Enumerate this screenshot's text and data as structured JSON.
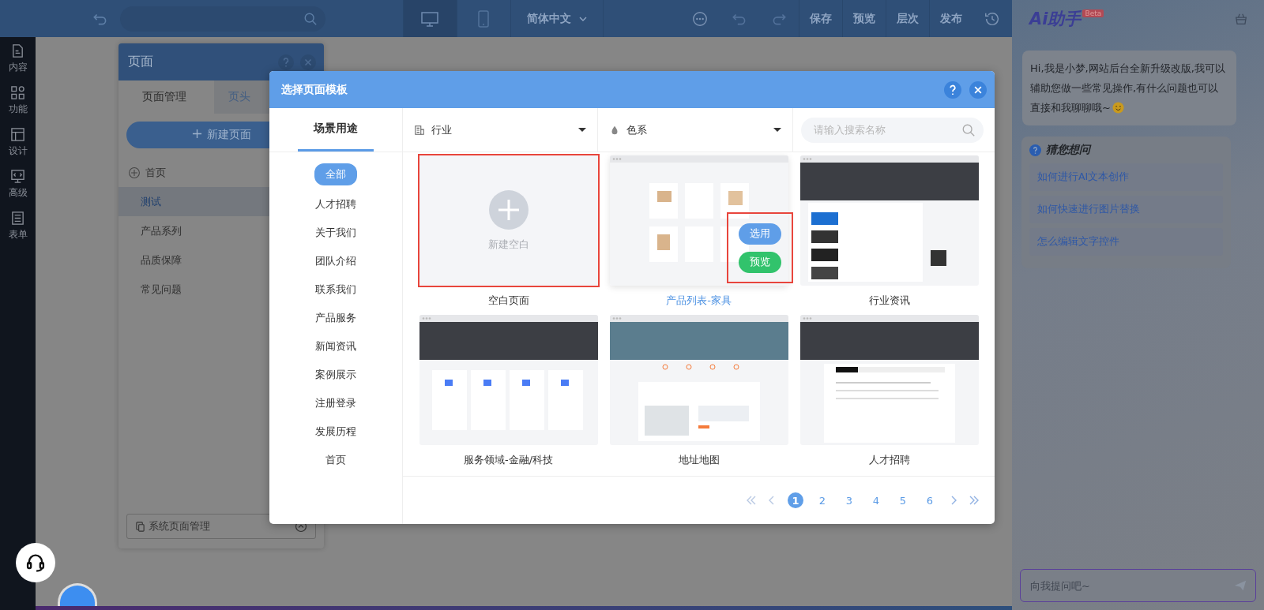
{
  "toolbar": {
    "language": "简体中文",
    "devices": [
      {
        "kind": "desktop",
        "selected": true
      },
      {
        "kind": "mobile",
        "selected": false
      }
    ],
    "actions": [
      "保存",
      "预览",
      "层次",
      "发布"
    ]
  },
  "sidebar": {
    "items": [
      {
        "kind": "doc",
        "label": "内容"
      },
      {
        "kind": "grid",
        "label": "功能"
      },
      {
        "kind": "layout",
        "label": "设计"
      },
      {
        "kind": "code",
        "label": "高级"
      },
      {
        "kind": "form",
        "label": "表单"
      }
    ]
  },
  "pages_panel": {
    "title": "页面",
    "tabs": [
      {
        "label": "页面管理",
        "selected": true
      },
      {
        "label": "页头",
        "selected": false
      }
    ],
    "new_button": "新建页面",
    "pages": [
      {
        "name": "首页",
        "home": true,
        "selected": false
      },
      {
        "name": "测试",
        "home": false,
        "selected": true
      },
      {
        "name": "产品系列",
        "home": false,
        "selected": false
      },
      {
        "name": "品质保障",
        "home": false,
        "selected": false
      },
      {
        "name": "常见问题",
        "home": false,
        "selected": false
      }
    ],
    "system_button": "系统页面管理"
  },
  "modal": {
    "title": "选择页面模板",
    "side_tab": "场景用途",
    "categories": [
      {
        "label": "全部",
        "selected": true
      },
      {
        "label": "人才招聘",
        "selected": false
      },
      {
        "label": "关于我们",
        "selected": false
      },
      {
        "label": "团队介绍",
        "selected": false
      },
      {
        "label": "联系我们",
        "selected": false
      },
      {
        "label": "产品服务",
        "selected": false
      },
      {
        "label": "新闻资讯",
        "selected": false
      },
      {
        "label": "案例展示",
        "selected": false
      },
      {
        "label": "注册登录",
        "selected": false
      },
      {
        "label": "发展历程",
        "selected": false
      },
      {
        "label": "首页",
        "selected": false
      }
    ],
    "filters": [
      {
        "kind": "industry",
        "label": "行业"
      },
      {
        "kind": "color",
        "label": "色系"
      }
    ],
    "search": {
      "placeholder": "请输入搜索名称"
    },
    "templates": [
      {
        "kind": "blank",
        "name": "空白页面",
        "blank_label": "新建空白",
        "hovered": false,
        "annotated": true
      },
      {
        "kind": "products",
        "name": "产品列表-家具",
        "hovered": true,
        "annotated": true,
        "actions": [
          {
            "kind": "use",
            "label": "选用"
          },
          {
            "kind": "preview",
            "label": "预览"
          }
        ]
      },
      {
        "kind": "news",
        "name": "行业资讯",
        "hovered": false,
        "annotated": false
      },
      {
        "kind": "service",
        "name": "服务领域-金融/科技",
        "hovered": false,
        "annotated": false
      },
      {
        "kind": "map",
        "name": "地址地图",
        "hovered": false,
        "annotated": false
      },
      {
        "kind": "jobs",
        "name": "人才招聘",
        "hovered": false,
        "annotated": false
      }
    ],
    "pagination": {
      "pages": [
        {
          "label": "1",
          "selected": true
        },
        {
          "label": "2",
          "selected": false
        },
        {
          "label": "3",
          "selected": false
        },
        {
          "label": "4",
          "selected": false
        },
        {
          "label": "5",
          "selected": false
        },
        {
          "label": "6",
          "selected": false
        }
      ]
    }
  },
  "assistant": {
    "logo": "Ai助手",
    "badge": "Beta",
    "greeting": "Hi,我是小梦,网站后台全新升级改版,我可以辅助您做一些常见操作,有什么问题也可以直接和我聊聊哦~",
    "suggest_title": "猜您想问",
    "suggestions": [
      "如何进行AI文本创作",
      "如何快速进行图片替换",
      "怎么编辑文字控件"
    ],
    "input": {
      "placeholder": "向我提问吧~"
    }
  }
}
